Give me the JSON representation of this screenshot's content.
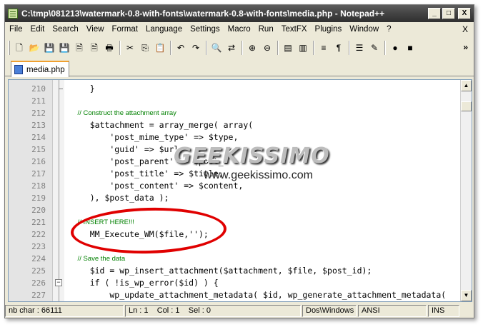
{
  "window": {
    "title": "C:\\tmp\\081213\\watermark-0.8-with-fonts\\watermark-0.8-with-fonts\\media.php - Notepad++",
    "minimize": "_",
    "maximize": "□",
    "close": "X"
  },
  "menu": {
    "items": [
      "File",
      "Edit",
      "Search",
      "View",
      "Format",
      "Language",
      "Settings",
      "Macro",
      "Run",
      "TextFX",
      "Plugins",
      "Window",
      "?"
    ],
    "close": "X"
  },
  "toolbar": {
    "buttons": [
      {
        "icon": "new-file-icon",
        "glyph": "🗋"
      },
      {
        "icon": "open-file-icon",
        "glyph": "📂"
      },
      {
        "icon": "save-icon",
        "glyph": "💾"
      },
      {
        "icon": "save-all-icon",
        "glyph": "💾"
      },
      {
        "icon": "close-file-icon",
        "glyph": "🗎"
      },
      {
        "icon": "close-all-icon",
        "glyph": "🗎"
      },
      {
        "icon": "print-icon",
        "glyph": "🖶"
      },
      {
        "icon": "cut-icon",
        "glyph": "✂"
      },
      {
        "icon": "copy-icon",
        "glyph": "⎘"
      },
      {
        "icon": "paste-icon",
        "glyph": "📋"
      },
      {
        "icon": "undo-icon",
        "glyph": "↶"
      },
      {
        "icon": "redo-icon",
        "glyph": "↷"
      },
      {
        "icon": "find-icon",
        "glyph": "🔍"
      },
      {
        "icon": "replace-icon",
        "glyph": "⇄"
      },
      {
        "icon": "zoom-in-icon",
        "glyph": "⊕"
      },
      {
        "icon": "zoom-out-icon",
        "glyph": "⊖"
      },
      {
        "icon": "sync-vertical-icon",
        "glyph": "▤"
      },
      {
        "icon": "sync-horizontal-icon",
        "glyph": "▥"
      },
      {
        "icon": "word-wrap-icon",
        "glyph": "≡"
      },
      {
        "icon": "show-all-chars-icon",
        "glyph": "¶"
      },
      {
        "icon": "indent-guide-icon",
        "glyph": "☰"
      },
      {
        "icon": "user-lang-icon",
        "glyph": "✎"
      },
      {
        "icon": "record-macro-icon",
        "glyph": "●"
      },
      {
        "icon": "stop-macro-icon",
        "glyph": "■"
      }
    ],
    "more": "»"
  },
  "tab": {
    "label": "media.php"
  },
  "editor": {
    "lines": [
      {
        "num": "210",
        "text": "    }",
        "type": "code"
      },
      {
        "num": "211",
        "text": "",
        "type": "code"
      },
      {
        "num": "212",
        "text": "    // Construct the attachment array",
        "type": "comment"
      },
      {
        "num": "213",
        "text": "    $attachment = array_merge( array(",
        "type": "code"
      },
      {
        "num": "214",
        "text": "        'post_mime_type' => $type,",
        "type": "code"
      },
      {
        "num": "215",
        "text": "        'guid' => $url,",
        "type": "code"
      },
      {
        "num": "216",
        "text": "        'post_parent' => $post_i",
        "type": "code"
      },
      {
        "num": "217",
        "text": "        'post_title' => $title,",
        "type": "code"
      },
      {
        "num": "218",
        "text": "        'post_content' => $content,",
        "type": "code"
      },
      {
        "num": "219",
        "text": "    ), $post_data );",
        "type": "code"
      },
      {
        "num": "220",
        "text": "",
        "type": "code"
      },
      {
        "num": "221",
        "text": "    // INSERT HERE!!!",
        "type": "comment"
      },
      {
        "num": "222",
        "text": "    MM_Execute_WM($file,'');",
        "type": "code"
      },
      {
        "num": "223",
        "text": "",
        "type": "code"
      },
      {
        "num": "224",
        "text": "    // Save the data",
        "type": "comment"
      },
      {
        "num": "225",
        "text": "    $id = wp_insert_attachment($attachment, $file, $post_id);",
        "type": "code"
      },
      {
        "num": "226",
        "text": "    if ( !is_wp_error($id) ) {",
        "type": "code"
      },
      {
        "num": "227",
        "text": "        wp_update_attachment_metadata( $id, wp_generate_attachment_metadata(",
        "type": "code"
      }
    ]
  },
  "watermark": {
    "logo": "GEEKISSIMO",
    "url": "www.geekissimo.com"
  },
  "status": {
    "chars": "nb char : 66111",
    "position": "Ln : 1    Col : 1    Sel : 0",
    "eol": "Dos\\Windows",
    "encoding": "ANSI",
    "mode": "INS"
  },
  "colors": {
    "highlight_ellipse": "#e00000",
    "comment": "#008000",
    "tab_accent": "#f0a030"
  }
}
